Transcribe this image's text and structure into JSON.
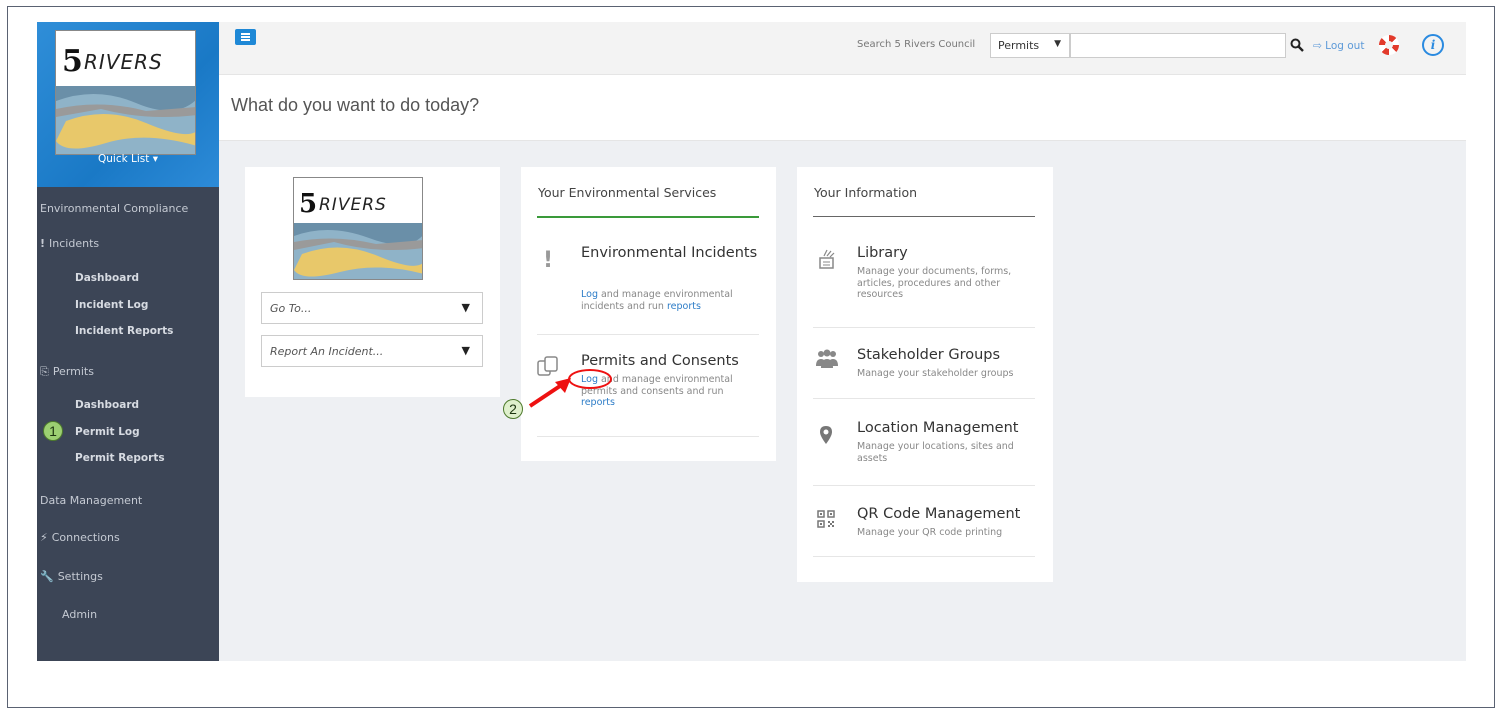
{
  "sidebar": {
    "logo_text": "5RIVERS",
    "quick_list": "Quick List",
    "items": [
      {
        "label": "Environmental Compliance"
      },
      {
        "label": "Incidents",
        "icon": "exclamation-icon"
      },
      {
        "label": "Dashboard"
      },
      {
        "label": "Incident Log"
      },
      {
        "label": "Incident Reports"
      },
      {
        "label": "Permits",
        "icon": "permits-icon"
      },
      {
        "label": "Dashboard"
      },
      {
        "label": "Permit Log"
      },
      {
        "label": "Permit Reports"
      },
      {
        "label": "Data Management"
      },
      {
        "label": "Connections",
        "icon": "plug-icon"
      },
      {
        "label": "Settings",
        "icon": "wrench-icon"
      },
      {
        "label": "Admin"
      }
    ]
  },
  "topbar": {
    "search_label": "Search 5 Rivers Council",
    "search_scope": "Permits",
    "search_value": "",
    "logout": "Log out"
  },
  "page": {
    "title": "What do you want to do today?"
  },
  "quick_panel": {
    "logo_text": "5RIVERS",
    "goto": "Go To...",
    "report": "Report An Incident..."
  },
  "services": {
    "title": "Your Environmental Services",
    "accent": "#3a9a3a",
    "items": [
      {
        "title": "Environmental Incidents",
        "link1": "Log",
        "desc_mid": " and manage environmental incidents and run ",
        "link2": "reports",
        "icon": "exclamation-icon"
      },
      {
        "title": "Permits and Consents",
        "link1": "Log",
        "desc_mid": " and manage environmental permits and consents and run",
        "link2": "reports",
        "icon": "permits-icon"
      }
    ]
  },
  "information": {
    "title": "Your Information",
    "accent": "#666666",
    "items": [
      {
        "title": "Library",
        "desc": "Manage your documents, forms, articles, procedures and other resources",
        "icon": "library-icon"
      },
      {
        "title": "Stakeholder Groups",
        "desc": "Manage your stakeholder groups",
        "icon": "group-icon"
      },
      {
        "title": "Location Management",
        "desc": "Manage your locations, sites and assets",
        "icon": "location-pin-icon"
      },
      {
        "title": "QR Code Management",
        "desc": "Manage your QR code printing",
        "icon": "qr-code-icon"
      }
    ]
  },
  "annotations": {
    "step1": "1",
    "step2": "2"
  }
}
